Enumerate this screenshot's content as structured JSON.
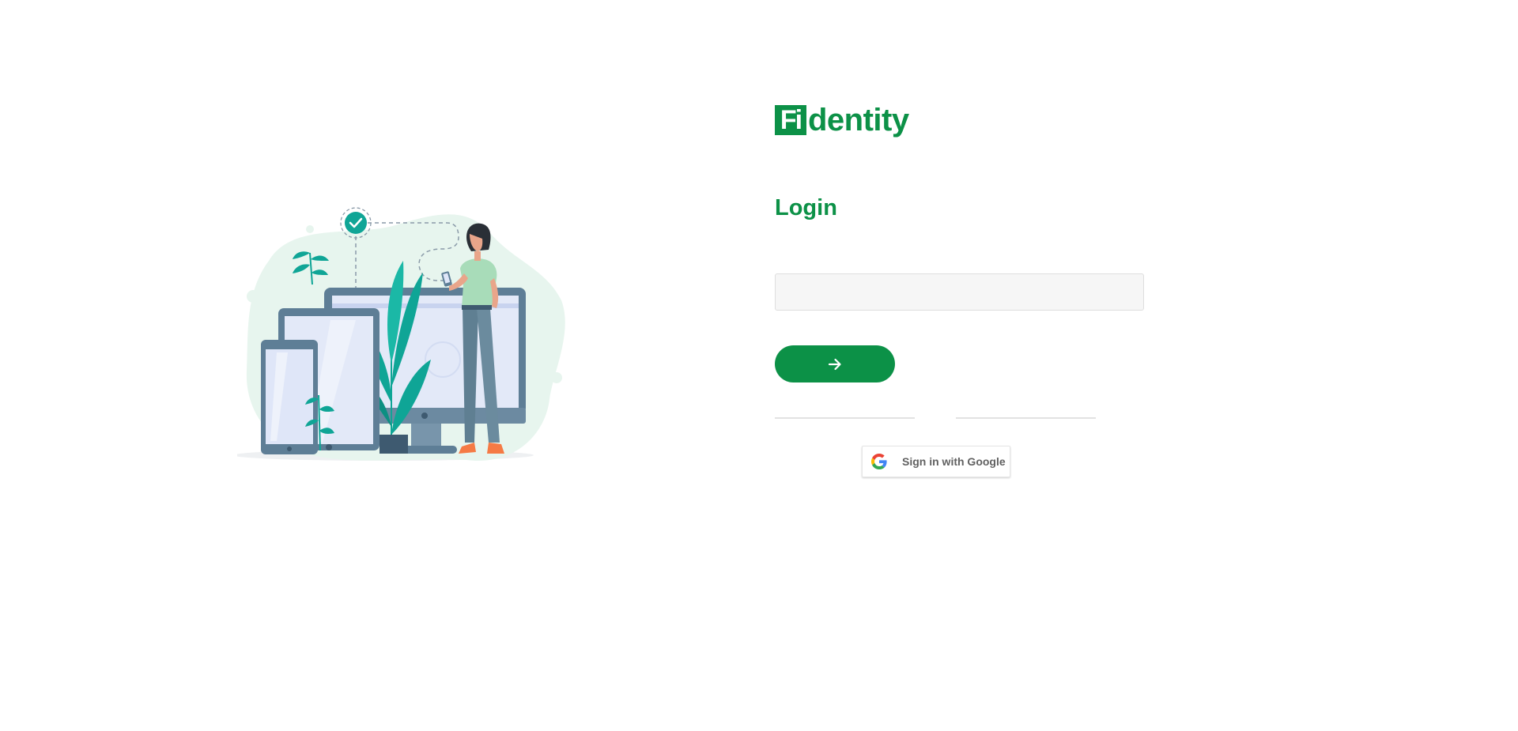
{
  "brand": {
    "logo_box_text": "Fi",
    "logo_rest_text": "dentity",
    "color": "#0c9147"
  },
  "login": {
    "title": "Login",
    "input_placeholder": "",
    "input_value": "",
    "submit_icon": "arrow-right-icon"
  },
  "divider": {
    "text": ""
  },
  "google": {
    "label": "Sign in with Google",
    "icon": "google-g-icon"
  },
  "illustration": {
    "description_icon": "person-with-devices-illustration",
    "check_icon": "check-circle-icon"
  }
}
